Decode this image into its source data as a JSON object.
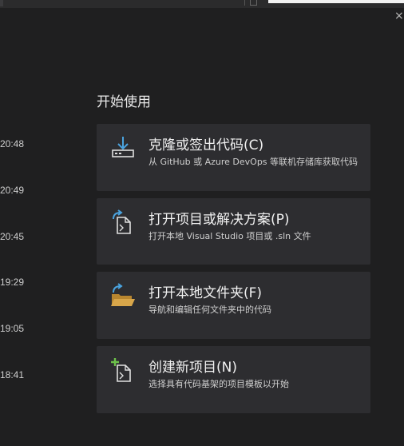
{
  "recent": {
    "times": [
      "20:48",
      "20:49",
      "20:45",
      "19:29",
      "19:05",
      "18:41"
    ]
  },
  "get_started": {
    "title": "开始使用",
    "cards": [
      {
        "title": "克隆或签出代码(C)",
        "desc": "从 GitHub 或 Azure DevOps 等联机存储库获取代码",
        "icon": "clone-icon"
      },
      {
        "title": "打开项目或解决方案(P)",
        "desc": "打开本地 Visual Studio 项目或 .sln 文件",
        "icon": "open-project-icon"
      },
      {
        "title": "打开本地文件夹(F)",
        "desc": "导航和编辑任何文件夹中的代码",
        "icon": "open-folder-icon"
      },
      {
        "title": "创建新项目(N)",
        "desc": "选择具有代码基架的项目模板以开始",
        "icon": "new-project-icon"
      }
    ]
  },
  "window": {
    "close_glyph": "×"
  },
  "colors": {
    "background": "#1f1f20",
    "card": "#2d2d30",
    "accent_blue": "#4aa3df",
    "accent_green": "#6cc04a",
    "folder_yellow": "#d8a64a"
  }
}
